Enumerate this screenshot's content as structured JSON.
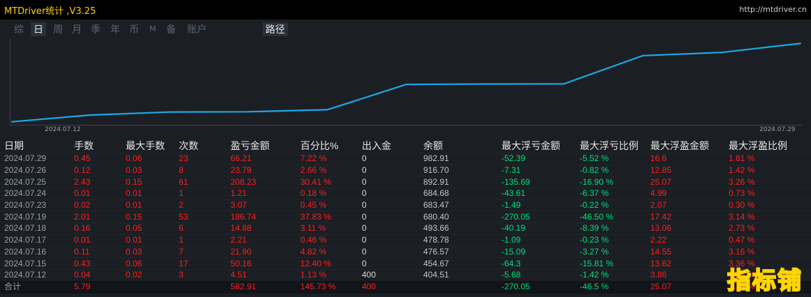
{
  "window": {
    "title": "MTDriver统计 ,V3.25",
    "url": "http://mtdriver.cn"
  },
  "tabs": [
    {
      "label": "综"
    },
    {
      "label": "日"
    },
    {
      "label": "周"
    },
    {
      "label": "月"
    },
    {
      "label": "季"
    },
    {
      "label": "年"
    },
    {
      "label": "币"
    },
    {
      "label": "M"
    },
    {
      "label": "备"
    },
    {
      "label": "账户"
    },
    {
      "label": "路径"
    }
  ],
  "active_tab": "日",
  "colors": {
    "line": "#1ea8e8",
    "positive": "#ff1f1f",
    "negative": "#00e07a",
    "brand": "#ffd400"
  },
  "chart_data": {
    "type": "line",
    "x_tick_labels": [
      "2024.07.12",
      "2024.07.29"
    ],
    "x": [
      "2024.07.12",
      "2024.07.15",
      "2024.07.16",
      "2024.07.17",
      "2024.07.18",
      "2024.07.19",
      "2024.07.23",
      "2024.07.24",
      "2024.07.25",
      "2024.07.26",
      "2024.07.29"
    ],
    "values": [
      404.51,
      454.67,
      476.57,
      478.78,
      493.66,
      680.4,
      683.47,
      684.68,
      892.91,
      916.7,
      982.91
    ]
  },
  "table": {
    "headers": [
      "日期",
      "手数",
      "最大手数",
      "次数",
      "盈亏金额",
      "百分比%",
      "出入金",
      "余额",
      "最大浮亏金额",
      "最大浮亏比例",
      "最大浮盈金额",
      "最大浮盈比例"
    ],
    "rows": [
      [
        "2024.07.29",
        "0.45",
        "0.06",
        "23",
        "66.21",
        "7.22 %",
        "0",
        "982.91",
        "-52.39",
        "-5.52 %",
        "16.6",
        "1.81 %"
      ],
      [
        "2024.07.26",
        "0.12",
        "0.03",
        "8",
        "23.79",
        "2.66 %",
        "0",
        "916.70",
        "-7.31",
        "-0.82 %",
        "12.85",
        "1.42 %"
      ],
      [
        "2024.07.25",
        "2.43",
        "0.15",
        "61",
        "208.23",
        "30.41 %",
        "0",
        "892.91",
        "-135.69",
        "-16.90 %",
        "25.07",
        "3.26 %"
      ],
      [
        "2024.07.24",
        "0.01",
        "0.01",
        "1",
        "1.21",
        "0.18 %",
        "0",
        "684.68",
        "-43.61",
        "-6.37 %",
        "4.99",
        "0.73 %"
      ],
      [
        "2024.07.23",
        "0.02",
        "0.01",
        "2",
        "3.07",
        "0.45 %",
        "0",
        "683.47",
        "-1.49",
        "-0.22 %",
        "2.07",
        "0.30 %"
      ],
      [
        "2024.07.19",
        "2.01",
        "0.15",
        "53",
        "186.74",
        "37.83 %",
        "0",
        "680.40",
        "-270.05",
        "-46.50 %",
        "17.42",
        "3.14 %"
      ],
      [
        "2024.07.18",
        "0.16",
        "0.05",
        "6",
        "14.88",
        "3.11 %",
        "0",
        "493.66",
        "-40.19",
        "-8.39 %",
        "13.06",
        "2.73 %"
      ],
      [
        "2024.07.17",
        "0.01",
        "0.01",
        "1",
        "2.21",
        "0.46 %",
        "0",
        "478.78",
        "-1.09",
        "-0.23 %",
        "2.22",
        "0.47 %"
      ],
      [
        "2024.07.16",
        "0.11",
        "0.03",
        "7",
        "21.90",
        "4.82 %",
        "0",
        "476.57",
        "-15.09",
        "-3.27 %",
        "14.55",
        "3.16 %"
      ],
      [
        "2024.07.15",
        "0.43",
        "0.06",
        "17",
        "50.16",
        "12.40 %",
        "0",
        "454.67",
        "-64.3",
        "-15.81 %",
        "13.62",
        "3.36 %"
      ],
      [
        "2024.07.12",
        "0.04",
        "0.02",
        "3",
        "4.51",
        "1.13 %",
        "400",
        "404.51",
        "-5.68",
        "-1.42 %",
        "3.86",
        "0.96 %"
      ]
    ],
    "total": [
      "合计",
      "5.79",
      "",
      "",
      "582.91",
      "145.73 %",
      "400",
      "",
      "-270.05",
      "-46.5 %",
      "25.07",
      "3.26 %"
    ]
  },
  "watermark": "指标铺"
}
